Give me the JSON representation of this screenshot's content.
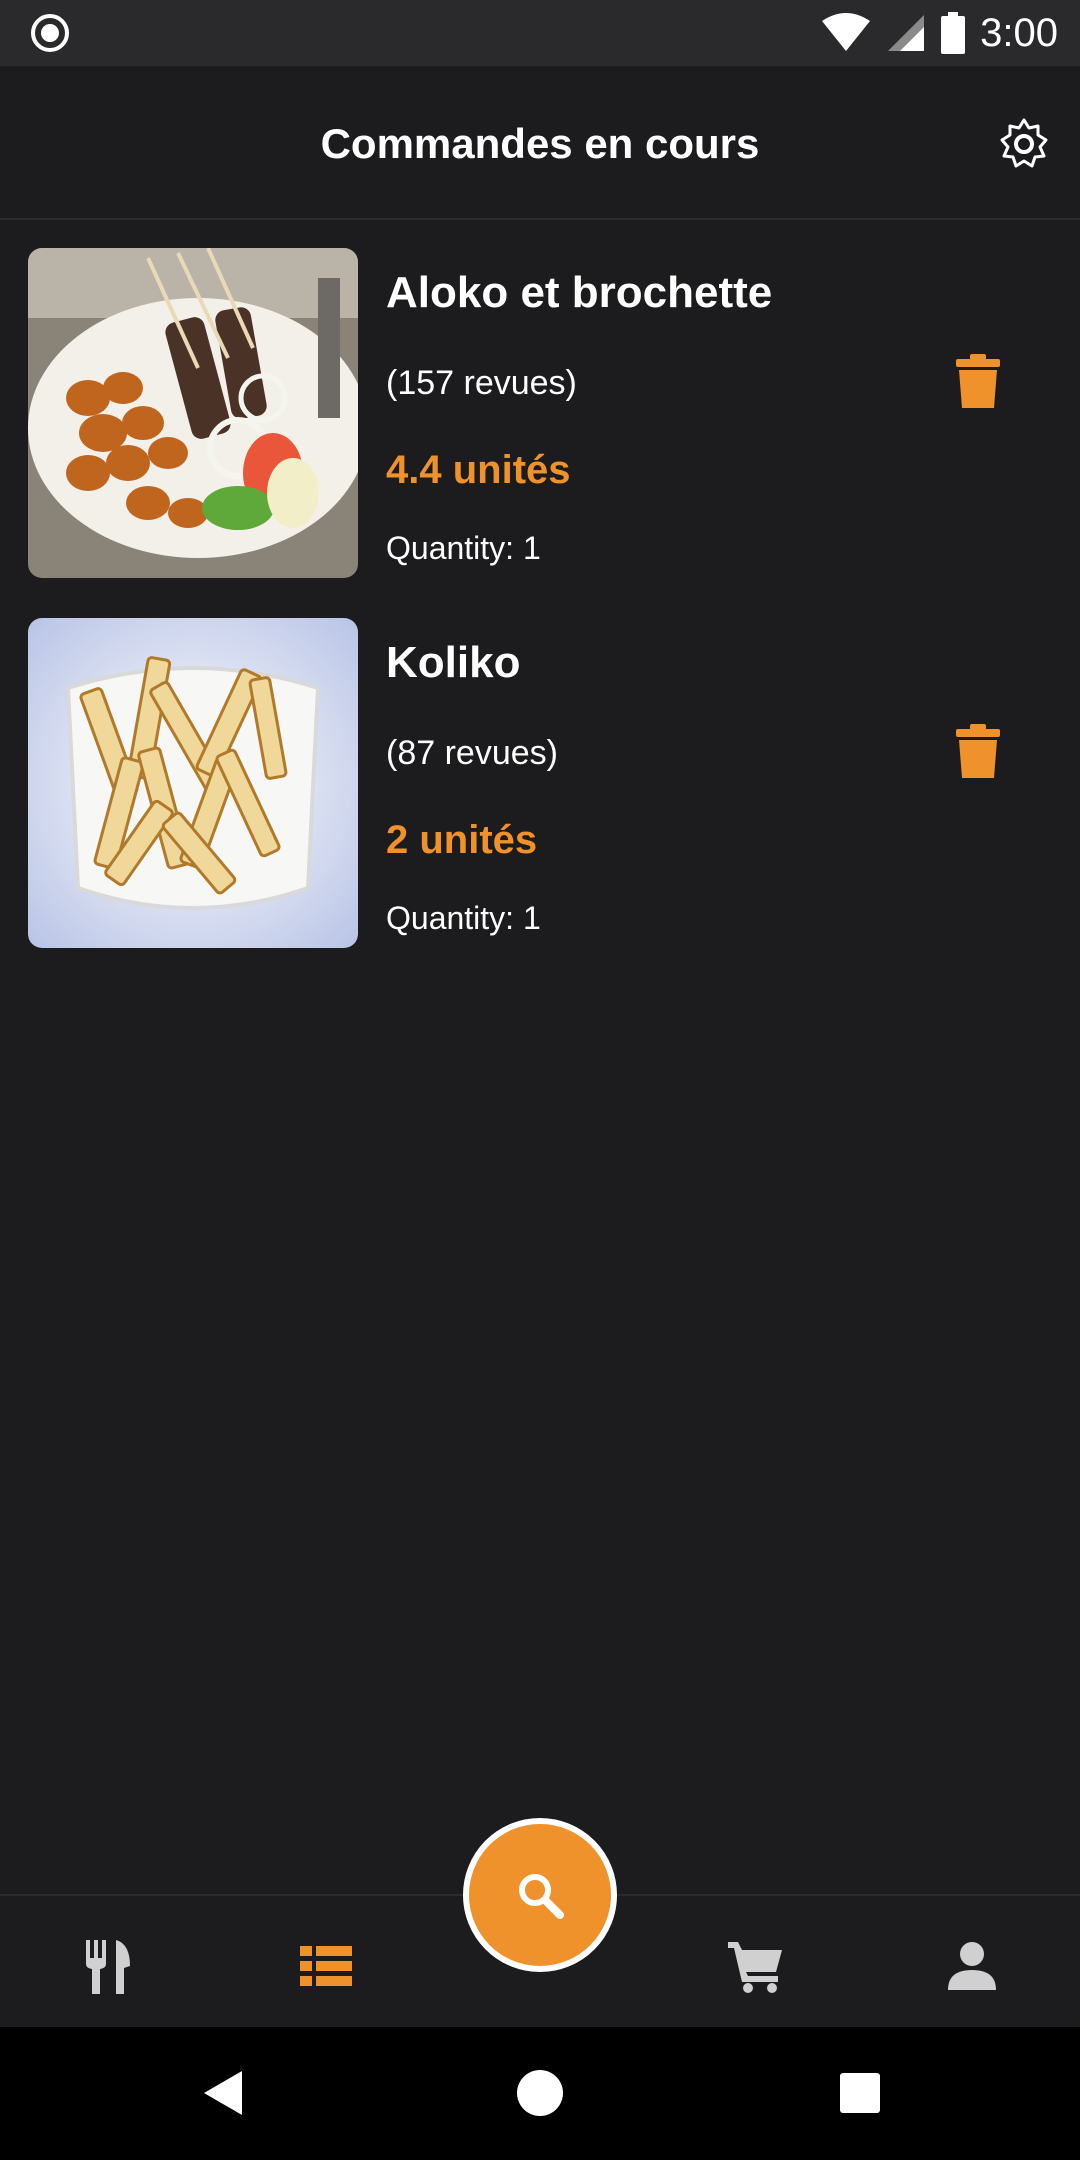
{
  "status_bar": {
    "time": "3:00"
  },
  "header": {
    "title": "Commandes en cours"
  },
  "orders": [
    {
      "name": "Aloko et brochette",
      "reviews": "(157 revues)",
      "price": "4.4 unités",
      "quantity": "Quantity: 1"
    },
    {
      "name": "Koliko",
      "reviews": "(87 revues)",
      "price": "2 unités",
      "quantity": "Quantity: 1"
    }
  ],
  "bottom_nav": {
    "items": [
      {
        "icon": "restaurant-icon",
        "active": false
      },
      {
        "icon": "list-icon",
        "active": true
      },
      {
        "icon": "search-icon",
        "active": false
      },
      {
        "icon": "cart-icon",
        "active": false
      },
      {
        "icon": "profile-icon",
        "active": false
      }
    ]
  },
  "colors": {
    "accent": "#f0922b",
    "background": "#1c1c1e",
    "text": "#ffffff"
  }
}
